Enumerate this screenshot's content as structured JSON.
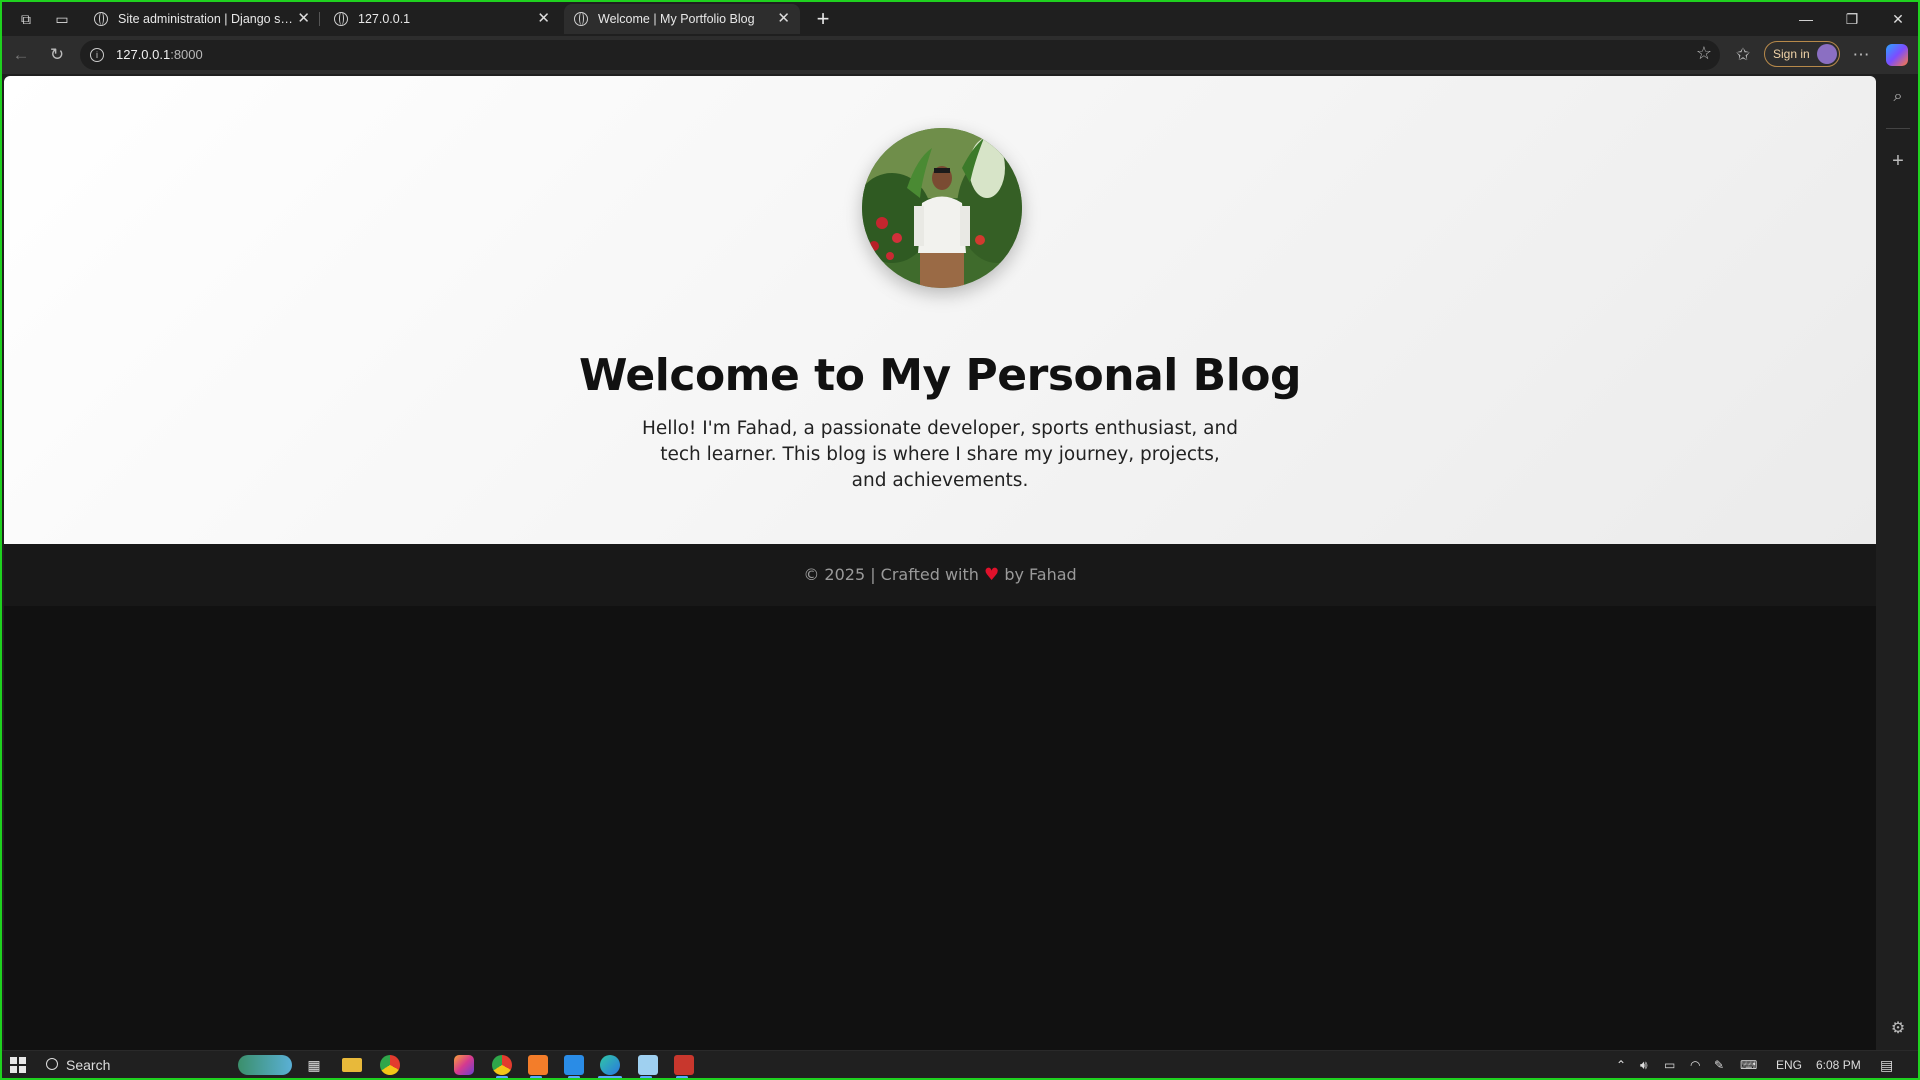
{
  "browser": {
    "tabs": [
      {
        "label": "Site administration | Django site admin",
        "active": false
      },
      {
        "label": "127.0.0.1",
        "active": false
      },
      {
        "label": "Welcome | My Portfolio Blog",
        "active": true
      }
    ],
    "new_tab_label": "+",
    "url_host": "127.0.0.1",
    "url_port": ":8000",
    "signin_label": "Sign in"
  },
  "page": {
    "heading": "Welcome to My Personal Blog",
    "intro": "Hello! I'm Fahad, a passionate developer, sports enthusiast, and tech learner. This blog is where I share my journey, projects, and achievements.",
    "footer_prefix": "© 2025 | Crafted with",
    "footer_heart": "♥",
    "footer_suffix": "by Fahad"
  },
  "taskbar": {
    "search_label": "Search",
    "language": "ENG",
    "time": "6:08 PM"
  },
  "colors": {
    "window_border": "#1fd11f",
    "footer_bg": "#181818",
    "heart": "#e0112b"
  },
  "icons": [
    "workspaces-icon",
    "tab-actions-icon",
    "globe-icon",
    "close-icon",
    "back-icon",
    "reload-icon",
    "info-icon",
    "favorite-star-icon",
    "favorites-icon",
    "more-icon",
    "copilot-icon",
    "search-icon",
    "add-icon",
    "settings-icon",
    "windows-start-icon"
  ]
}
